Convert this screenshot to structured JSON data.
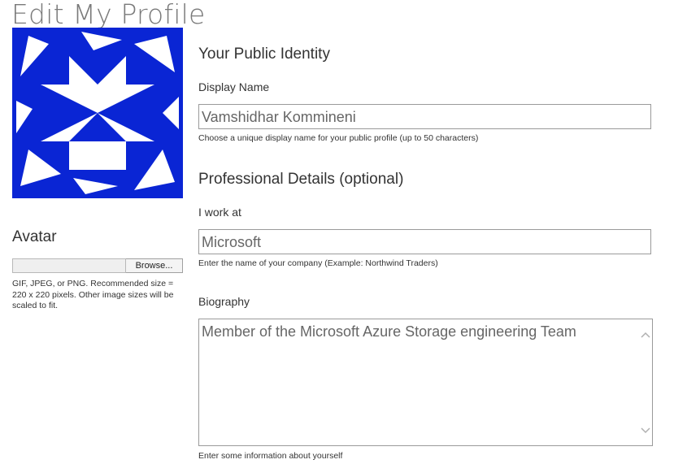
{
  "page": {
    "title": "Edit My Profile"
  },
  "avatar": {
    "heading": "Avatar",
    "browse_label": "Browse...",
    "hint": "GIF, JPEG, or PNG. Recommended size = 220 x 220 pixels. Other image sizes will be scaled to fit.",
    "image_colors": {
      "primary": "#0a25d4",
      "background": "#ffffff"
    }
  },
  "public_identity": {
    "heading": "Your Public Identity",
    "display_name_label": "Display Name",
    "display_name_value": "Vamshidhar Kommineni",
    "display_name_hint": "Choose a unique display name for your public profile (up to 50 characters)"
  },
  "professional": {
    "heading": "Professional Details (optional)",
    "work_label": "I work at",
    "work_value": "Microsoft",
    "work_hint": "Enter the name of your company (Example: Northwind Traders)",
    "bio_label": "Biography",
    "bio_value": "Member of the Microsoft Azure Storage engineering Team",
    "bio_hint": "Enter some information about yourself"
  },
  "icons": {
    "scroll_up": "chevron-up-icon",
    "scroll_down": "chevron-down-icon"
  }
}
